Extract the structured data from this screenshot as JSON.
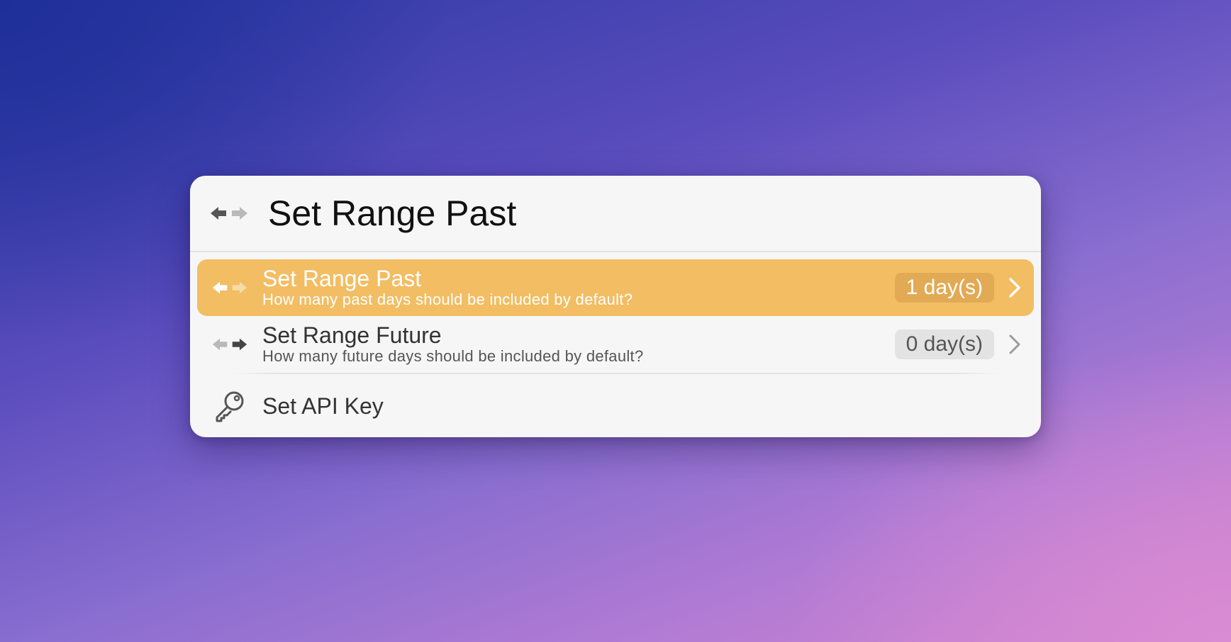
{
  "search": {
    "query": "Set Range Past",
    "icon": "arrows-left-right-icon"
  },
  "items": [
    {
      "title": "Set Range Past",
      "subtitle": "How many past days should be included by default?",
      "badge": "1 day(s)",
      "icon": "arrows-left-right-icon",
      "selected": true
    },
    {
      "title": "Set Range Future",
      "subtitle": "How many future days should be included by default?",
      "badge": "0 day(s)",
      "icon": "arrows-left-right-icon",
      "selected": false
    },
    {
      "title": "Set API Key",
      "icon": "key-icon",
      "selected": false
    }
  ],
  "colors": {
    "accent": "#f2bd63",
    "panel": "#f6f6f6"
  }
}
